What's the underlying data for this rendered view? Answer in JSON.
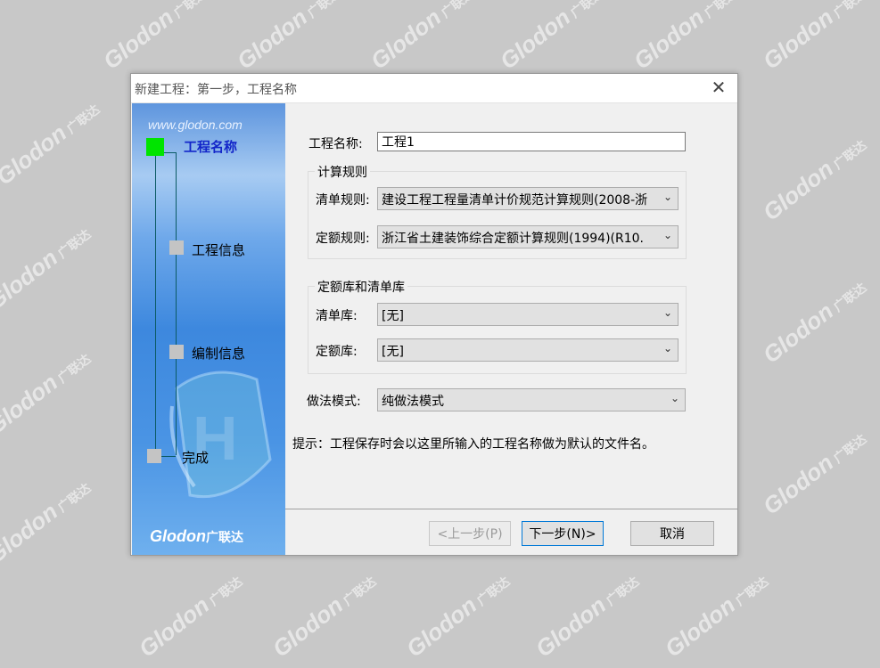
{
  "watermark": {
    "brand": "Glodon",
    "brand_cn": "广联达"
  },
  "dialog": {
    "title": "新建工程：第一步，工程名称",
    "close_glyph": "✕"
  },
  "sidebar": {
    "site": "www.glodon.com",
    "brand": "Glodon",
    "brand_cn": "广联达",
    "steps": [
      {
        "label": "工程名称",
        "active": true
      },
      {
        "label": "工程信息",
        "active": false
      },
      {
        "label": "编制信息",
        "active": false
      },
      {
        "label": "完成",
        "active": false
      }
    ]
  },
  "form": {
    "project_name_label": "工程名称:",
    "project_name_value": "工程1",
    "calc_rules_title": "计算规则",
    "bill_rule_label": "清单规则:",
    "bill_rule_value": "建设工程工程量清单计价规范计算规则(2008-浙",
    "quota_rule_label": "定额规则:",
    "quota_rule_value": "浙江省土建装饰综合定额计算规则(1994)(R10.",
    "library_title": "定额库和清单库",
    "bill_lib_label": "清单库:",
    "bill_lib_value": "[无]",
    "quota_lib_label": "定额库:",
    "quota_lib_value": "[无]",
    "method_label": "做法模式:",
    "method_value": "纯做法模式",
    "hint": "提示：工程保存时会以这里所输入的工程名称做为默认的文件名。"
  },
  "buttons": {
    "prev": "<上一步(P)",
    "next": "下一步(N)>",
    "cancel": "取消"
  },
  "colors": {
    "active_step": "#00e400",
    "active_label": "#1326c9",
    "inactive_step": "#c4c4c4"
  },
  "icons": {
    "dropdown": "chevron-down-icon",
    "close": "close-icon"
  }
}
